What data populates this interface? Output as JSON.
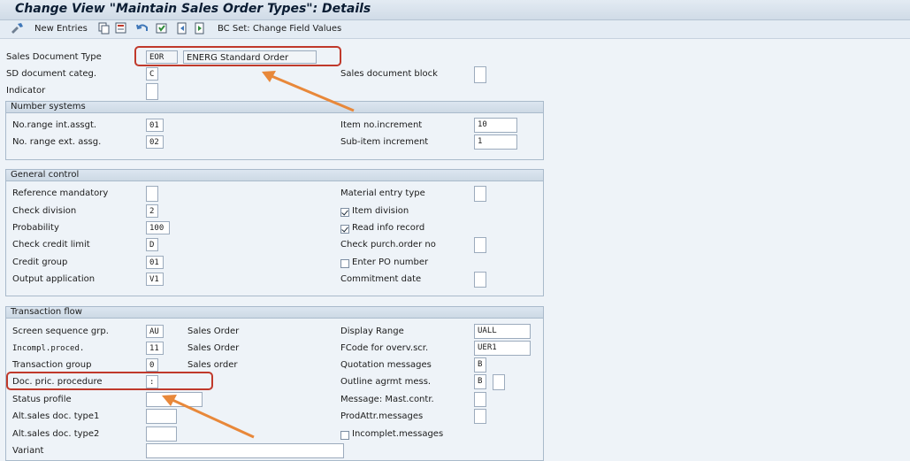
{
  "title": "Change View \"Maintain Sales Order Types\": Details",
  "toolbar": {
    "new_entries": "New Entries",
    "bc_set": "BC Set: Change Field Values"
  },
  "header": {
    "sales_doc_type_label": "Sales Document Type",
    "sales_doc_type_code": "EOR",
    "sales_doc_type_desc": "ENERG Standard Order",
    "sd_doc_categ_label": "SD document categ.",
    "sd_doc_categ_value": "C",
    "sales_doc_block_label": "Sales document block",
    "indicator_label": "Indicator"
  },
  "number_systems": {
    "title": "Number systems",
    "int_label": "No.range int.assgt.",
    "int_value": "01",
    "ext_label": "No. range ext. assg.",
    "ext_value": "02",
    "item_inc_label": "Item no.increment",
    "item_inc_value": "10",
    "subitem_inc_label": "Sub-item increment",
    "subitem_inc_value": "1"
  },
  "general_control": {
    "title": "General control",
    "ref_mandatory_label": "Reference mandatory",
    "check_division_label": "Check division",
    "check_division_value": "2",
    "probability_label": "Probability",
    "probability_value": "100",
    "check_credit_label": "Check credit limit",
    "check_credit_value": "D",
    "credit_group_label": "Credit group",
    "credit_group_value": "01",
    "output_app_label": "Output application",
    "output_app_value": "V1",
    "material_entry_label": "Material entry type",
    "item_division_label": "Item division",
    "item_division_checked": true,
    "read_info_label": "Read info record",
    "read_info_checked": true,
    "check_purch_label": "Check purch.order no",
    "enter_po_label": "Enter PO number",
    "enter_po_checked": false,
    "commitment_label": "Commitment  date"
  },
  "transaction_flow": {
    "title": "Transaction flow",
    "screen_seq_label": "Screen sequence grp.",
    "screen_seq_value": "AU",
    "screen_seq_desc": "Sales Order",
    "incompl_label": "Incompl.proced.",
    "incompl_value": "11",
    "incompl_desc": "Sales Order",
    "trans_group_label": "Transaction group",
    "trans_group_value": "0",
    "trans_group_desc": "Sales order",
    "doc_pric_label": "Doc. pric. procedure",
    "doc_pric_value": ":",
    "status_profile_label": "Status profile",
    "alt_type1_label": "Alt.sales doc. type1",
    "alt_type2_label": "Alt.sales doc. type2",
    "variant_label": "Variant",
    "display_range_label": "Display Range",
    "display_range_value": "UALL",
    "fcode_label": "FCode for overv.scr.",
    "fcode_value": "UER1",
    "quotation_label": "Quotation messages",
    "quotation_value": "B",
    "outline_label": "Outline agrmt mess.",
    "outline_value": "B",
    "mast_contr_label": "Message: Mast.contr.",
    "prodattr_label": "ProdAttr.messages",
    "incomplet_label": "Incomplet.messages",
    "incomplet_checked": false
  }
}
